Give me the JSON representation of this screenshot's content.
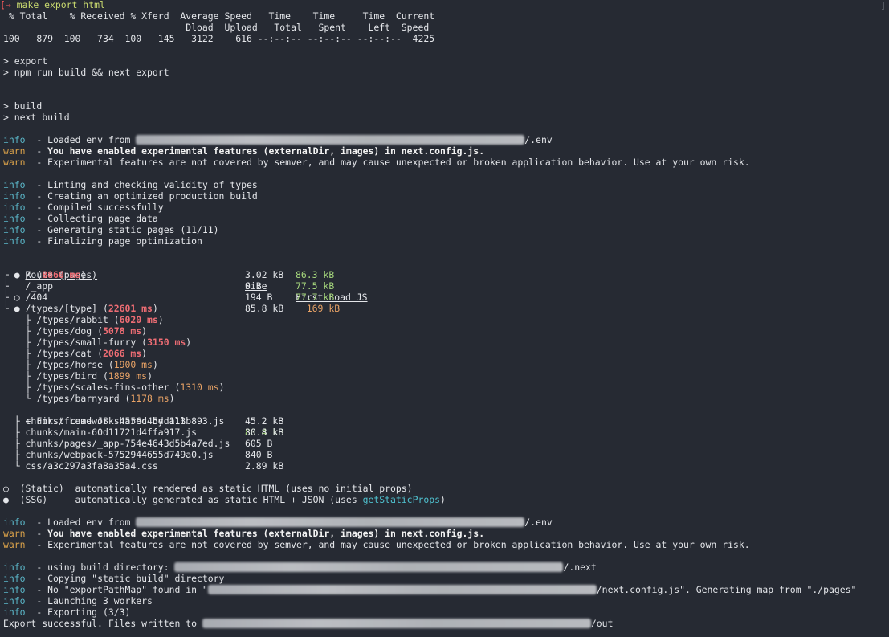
{
  "prompt": {
    "bracket": "[",
    "arrow": "→",
    "command": "make export_html",
    "corner": "]"
  },
  "curl": {
    "header1": " % Total    % Received % Xferd  Average Speed   Time    Time     Time  Current",
    "header2": "                                 Dload  Upload   Total   Spent    Left  Speed",
    "row": "100   879  100   734  100   145   3122    616 --:--:-- --:--:-- --:--:--  4225"
  },
  "npm": {
    "export1": "> export",
    "export2": "> npm run build && next export",
    "build1": "> build",
    "build2": "> next build"
  },
  "log1": [
    {
      "level": "info",
      "pre": "  - Loaded env from ",
      "suffix": "/.env",
      "bold": false
    },
    {
      "level": "warn",
      "text": "  - ",
      "boldtext": "You have enabled experimental features (externalDir, images) in next.config.js."
    },
    {
      "level": "warn",
      "text": "  - Experimental features are not covered by semver, and may cause unexpected or broken application behavior. Use at your own risk."
    }
  ],
  "log2": [
    {
      "level": "info",
      "text": "  - Linting and checking validity of types"
    },
    {
      "level": "info",
      "text": "  - Creating an optimized production build"
    },
    {
      "level": "info",
      "text": "  - Compiled successfully"
    },
    {
      "level": "info",
      "text": "  - Collecting page data"
    },
    {
      "level": "info",
      "text": "  - Generating static pages (11/11)"
    },
    {
      "level": "info",
      "text": "  - Finalizing page optimization"
    }
  ],
  "routes": {
    "header_route": "Route (pages)",
    "header_size": "Size",
    "header_first": "First Load JS",
    "rows": [
      {
        "prefix": "┌ ● ",
        "path": "/ (",
        "ms": "8860 ms",
        "ms_color": "red",
        "suffix": ")",
        "size": "3.02 kB",
        "first": "86.3 kB",
        "first_color": "green"
      },
      {
        "prefix": "├   ",
        "path": "/_app",
        "ms": "",
        "ms_color": "",
        "suffix": "",
        "size": "0 B",
        "first": "77.5 kB",
        "first_color": "green"
      },
      {
        "prefix": "├ ○ ",
        "path": "/404",
        "ms": "",
        "ms_color": "",
        "suffix": "",
        "size": "194 B",
        "first": "77.7 kB",
        "first_color": "green"
      },
      {
        "prefix": "└ ● ",
        "path": "/types/[type] (",
        "ms": "22601 ms",
        "ms_color": "red",
        "suffix": ")",
        "size": "85.8 kB",
        "first": "  169 kB",
        "first_color": "orange"
      }
    ],
    "subroutes": [
      {
        "prefix": "    ├ ",
        "path": "/types/rabbit (",
        "ms": "6020 ms",
        "ms_color": "red"
      },
      {
        "prefix": "    ├ ",
        "path": "/types/dog (",
        "ms": "5078 ms",
        "ms_color": "red"
      },
      {
        "prefix": "    ├ ",
        "path": "/types/small-furry (",
        "ms": "3150 ms",
        "ms_color": "red"
      },
      {
        "prefix": "    ├ ",
        "path": "/types/cat (",
        "ms": "2066 ms",
        "ms_color": "red"
      },
      {
        "prefix": "    ├ ",
        "path": "/types/horse (",
        "ms": "1900 ms",
        "ms_color": "orange"
      },
      {
        "prefix": "    ├ ",
        "path": "/types/bird (",
        "ms": "1899 ms",
        "ms_color": "orange"
      },
      {
        "prefix": "    ├ ",
        "path": "/types/scales-fins-other (",
        "ms": "1310 ms",
        "ms_color": "orange"
      },
      {
        "prefix": "    └ ",
        "path": "/types/barnyard (",
        "ms": "1178 ms",
        "ms_color": "orange"
      }
    ],
    "shared_label": "+ First Load JS shared by all",
    "shared_size": "80.4 kB",
    "chunks": [
      {
        "prefix": "  ├ ",
        "name": "chunks/framework-4556c45dd113b893.js",
        "size": "45.2 kB"
      },
      {
        "prefix": "  ├ ",
        "name": "chunks/main-60d11721d4ffa917.js",
        "size": "30.8 kB"
      },
      {
        "prefix": "  ├ ",
        "name": "chunks/pages/_app-754e4643d5b4a7ed.js",
        "size": "605 B"
      },
      {
        "prefix": "  ├ ",
        "name": "chunks/webpack-5752944655d749a0.js",
        "size": "840 B"
      },
      {
        "prefix": "  └ ",
        "name": "css/a3c297a3fa8a35a4.css",
        "size": "2.89 kB"
      }
    ]
  },
  "legend": {
    "static": "○  (Static)  automatically rendered as static HTML (uses no initial props)",
    "ssg_pre": "●  (SSG)     automatically generated as static HTML + JSON (uses ",
    "ssg_link": "getStaticProps",
    "ssg_post": ")"
  },
  "log3": {
    "env_pre": "  - Loaded env from ",
    "env_suffix": "/.env",
    "warn1_pre": "  - ",
    "warn1_bold": "You have enabled experimental features (externalDir, images) in next.config.js.",
    "warn2": "  - Experimental features are not covered by semver, and may cause unexpected or broken application behavior. Use at your own risk."
  },
  "log4": {
    "build_dir_pre": "  - using build directory: ",
    "build_dir_suffix": "/.next",
    "copying": "  - Copying \"static build\" directory",
    "no_map_pre": "  - No \"exportPathMap\" found in \"",
    "no_map_suffix": "/next.config.js\". Generating map from \"./pages\"",
    "launching": "  - Launching 3 workers",
    "exporting": "  - Exporting (3/3)",
    "success_pre": "Export successful. Files written to ",
    "success_suffix": "/out"
  },
  "labels": {
    "info": "info",
    "warn": "warn"
  },
  "colors": {
    "background": "#262a33",
    "info": "#5bb7c9",
    "warn": "#d9a14a",
    "green": "#a5d67c",
    "red": "#ee6d74",
    "orange": "#e9a366"
  }
}
